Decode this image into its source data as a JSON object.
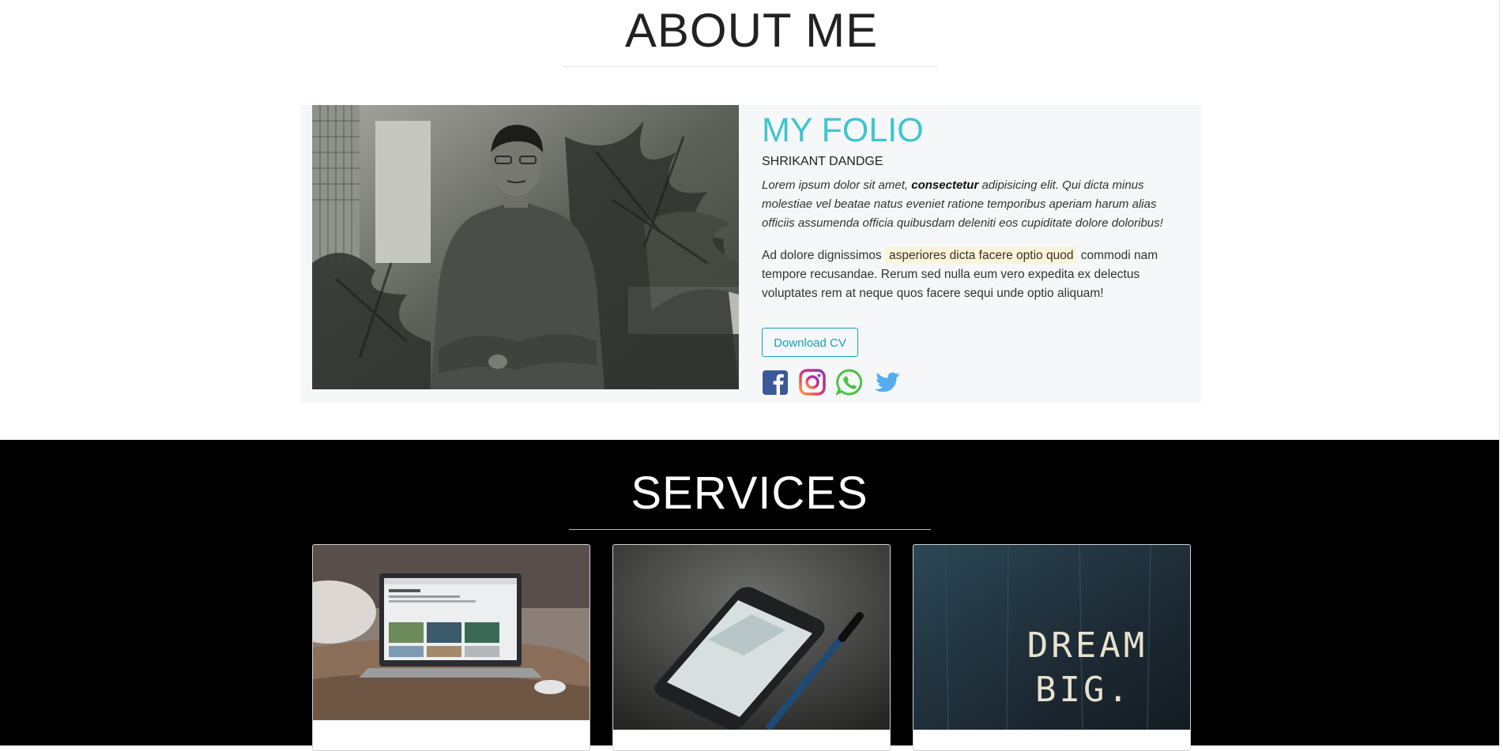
{
  "about": {
    "heading": "ABOUT ME",
    "title": "MY FOLIO",
    "name": "SHRIKANT DANDGE",
    "para1_start": "Lorem ipsum dolor sit amet, ",
    "para1_bold": "consectetur",
    "para1_end": " adipisicing elit. Qui dicta minus molestiae vel beatae natus eveniet ratione temporibus aperiam harum alias officiis assumenda officia quibusdam deleniti eos cupiditate dolore doloribus!",
    "para2_start": "Ad dolore dignissimos ",
    "para2_mark": "asperiores dicta facere optio quod",
    "para2_end": " commodi nam tempore recusandae. Rerum sed nulla eum vero expedita ex delectus voluptates rem at neque quos facere sequi unde optio aliquam!",
    "cv_button": "Download CV",
    "socials": [
      "facebook-icon",
      "instagram-icon",
      "whatsapp-icon",
      "twitter-icon"
    ]
  },
  "services": {
    "heading": "SERVICES",
    "cards": [
      {
        "image": "laptop-on-bed"
      },
      {
        "image": "phone-and-pen"
      },
      {
        "image": "dream-big-chalk"
      }
    ]
  },
  "colors": {
    "accent": "#3ec6cf",
    "button": "#17a2b8",
    "facebook": "#3b5998",
    "whatsapp": "#4dc247",
    "twitter": "#55acee"
  }
}
